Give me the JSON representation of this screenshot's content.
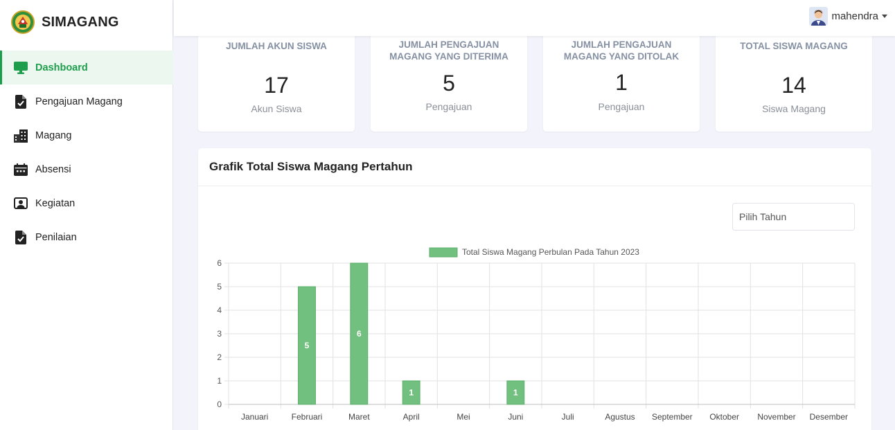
{
  "brand": {
    "name": "SIMAGANG"
  },
  "sidebar": {
    "items": [
      {
        "label": "Dashboard",
        "icon": "monitor-icon",
        "active": true
      },
      {
        "label": "Pengajuan Magang",
        "icon": "file-check-icon"
      },
      {
        "label": "Magang",
        "icon": "building-icon"
      },
      {
        "label": "Absensi",
        "icon": "calendar-icon"
      },
      {
        "label": "Kegiatan",
        "icon": "user-square-icon"
      },
      {
        "label": "Penilaian",
        "icon": "file-check-icon"
      }
    ]
  },
  "topbar": {
    "user_name": "mahendra"
  },
  "stats": [
    {
      "title": "JUMLAH AKUN SISWA",
      "value": "17",
      "sub": "Akun Siswa"
    },
    {
      "title": "JUMLAH PENGAJUAN MAGANG YANG DITERIMA",
      "value": "5",
      "sub": "Pengajuan"
    },
    {
      "title": "JUMLAH PENGAJUAN MAGANG YANG DITOLAK",
      "value": "1",
      "sub": "Pengajuan"
    },
    {
      "title": "TOTAL SISWA MAGANG",
      "value": "14",
      "sub": "Siswa Magang"
    }
  ],
  "chart_section": {
    "title": "Grafik Total Siswa Magang Pertahun",
    "year_placeholder": "Pilih Tahun"
  },
  "colors": {
    "accent": "#1e9e4c",
    "bar": "#72c07f"
  },
  "chart_data": {
    "type": "bar",
    "categories": [
      "Januari",
      "Februari",
      "Maret",
      "April",
      "Mei",
      "Juni",
      "Juli",
      "Agustus",
      "September",
      "Oktober",
      "November",
      "Desember"
    ],
    "series": [
      {
        "name": "Total Siswa Magang Perbulan Pada Tahun 2023",
        "values": [
          0,
          5,
          6,
          1,
          0,
          1,
          0,
          0,
          0,
          0,
          0,
          0
        ]
      }
    ],
    "yticks": [
      "0",
      "1",
      "2",
      "3",
      "4",
      "5",
      "6"
    ],
    "ylim": [
      0,
      6
    ],
    "grid": true,
    "legend": "top-center",
    "data_labels": true
  }
}
